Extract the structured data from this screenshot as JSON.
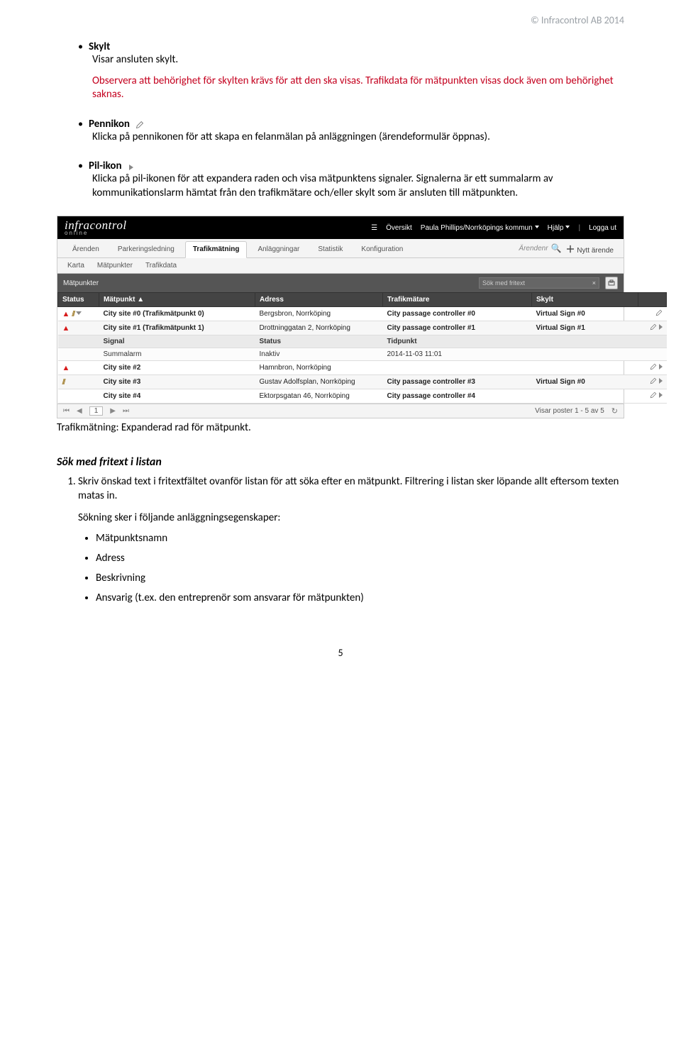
{
  "header": {
    "copyright": "© Infracontrol AB 2014"
  },
  "body": {
    "skylt": {
      "title": "Skylt",
      "line1": "Visar ansluten skylt.",
      "note": "Observera att behörighet för skylten krävs för att den ska visas. Trafikdata för mätpunkten visas dock även om behörighet saknas."
    },
    "pennikon": {
      "title": "Pennikon",
      "text": "Klicka på pennikonen för att skapa en felanmälan på anläggningen (ärendeformulär öppnas)."
    },
    "pilikon": {
      "title": "Pil-ikon",
      "text": "Klicka på pil-ikonen för att expandera raden och visa mätpunktens signaler. Signalerna är ett summalarm av kommunikationslarm hämtat från den trafikmätare och/eller skylt som är ansluten till mätpunkten."
    }
  },
  "app": {
    "brand": "infracontrol",
    "brandSub": "online",
    "top": {
      "grid": "☰",
      "overview": "Översikt",
      "user": "Paula Phillips/Norrköpings kommun",
      "help": "Hjälp",
      "logout": "Logga ut"
    },
    "tabs": [
      "Ärenden",
      "Parkeringsledning",
      "Trafikmätning",
      "Anläggningar",
      "Statistik",
      "Konfiguration"
    ],
    "tabsActive": 2,
    "topRight": {
      "label": "Ärendenr",
      "new": "Nytt ärende"
    },
    "subtabs": [
      "Karta",
      "Mätpunkter",
      "Trafikdata"
    ],
    "bar": {
      "title": "Mätpunkter",
      "searchPlaceholder": "Sök med fritext"
    },
    "cols": {
      "status": "Status",
      "mp": "Mätpunkt ▲",
      "addr": "Adress",
      "tm": "Trafikmätare",
      "skylt": "Skylt"
    },
    "rows": [
      {
        "status": [
          "warn",
          "hatch",
          "down"
        ],
        "mp": "City site #0 (Trafikmätpunkt 0)",
        "addr": "Bergsbron, Norrköping",
        "tm": "City passage controller #0",
        "skylt": "Virtual Sign #0",
        "act": [
          "pencil"
        ]
      },
      {
        "status": [
          "warn"
        ],
        "mp": "City site #1 (Trafikmätpunkt 1)",
        "addr": "Drottninggatan 2, Norrköping",
        "tm": "City passage controller #1",
        "skylt": "Virtual Sign #1",
        "act": [
          "pencil",
          "right"
        ]
      }
    ],
    "subHead": {
      "signal": "Signal",
      "status": "Status",
      "tid": "Tidpunkt"
    },
    "subRow": {
      "signal": "Summalarm",
      "status": "Inaktiv",
      "tid": "2014-11-03 11:01"
    },
    "rows2": [
      {
        "status": [
          "warn"
        ],
        "mp": "City site #2",
        "addr": "Hamnbron, Norrköping",
        "tm": "",
        "skylt": "",
        "act": [
          "pencil",
          "right"
        ]
      },
      {
        "status": [
          "hatch"
        ],
        "mp": "City site #3",
        "addr": "Gustav Adolfsplan, Norrköping",
        "tm": "City passage controller #3",
        "skylt": "Virtual Sign #0",
        "act": [
          "pencil",
          "right"
        ]
      },
      {
        "status": [],
        "mp": "City site #4",
        "addr": "Ektorpsgatan 46, Norrköping",
        "tm": "City passage controller #4",
        "skylt": "",
        "act": [
          "pencil",
          "right"
        ]
      }
    ],
    "pager": {
      "page": "1",
      "summary": "Visar poster 1 - 5 av 5"
    }
  },
  "caption": "Trafikmätning: Expanderad rad för mätpunkt.",
  "sok": {
    "heading": "Sök med fritext i listan",
    "step1": "Skriv önskad text i fritextfältet ovanför listan för att söka efter en mätpunkt. Filtrering i listan sker löpande allt eftersom texten matas in.",
    "step1b": "Sökning sker i följande anläggningsegenskaper:",
    "props": [
      "Mätpunktsnamn",
      "Adress",
      "Beskrivning",
      "Ansvarig (t.ex. den entreprenör som ansvarar för mätpunkten)"
    ]
  },
  "pageNum": "5"
}
